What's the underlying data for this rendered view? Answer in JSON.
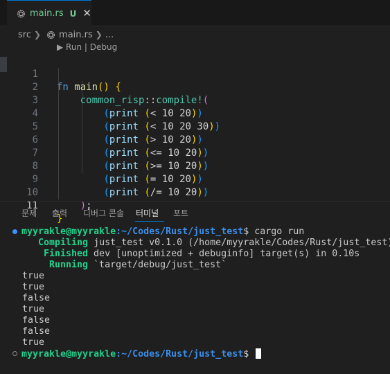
{
  "tab": {
    "filename": "main.rs",
    "git_status": "U",
    "close_glyph": "✕"
  },
  "breadcrumb": {
    "folder": "src",
    "file": "main.rs",
    "more": "..."
  },
  "codelens": "▶ Run | Debug",
  "code": {
    "line_numbers": [
      "1",
      "2",
      "3",
      "4",
      "5",
      "6",
      "7",
      "8",
      "9",
      "10",
      "11"
    ],
    "l1": {
      "kw": "fn",
      "name": "main",
      "parens": "()",
      "brace": "{"
    },
    "l2": {
      "mod": "common_risp",
      "sep": "::",
      "mac": "compile",
      "bang": "!",
      "open": "("
    },
    "prints": [
      {
        "op": "<",
        "args": "10 20"
      },
      {
        "op": "<",
        "args": "10 20 30"
      },
      {
        "op": ">",
        "args": "10 20"
      },
      {
        "op": "<=",
        "args": "10 20"
      },
      {
        "op": ">=",
        "args": "10 20"
      },
      {
        "op": "=",
        "args": "10 20"
      },
      {
        "op": "/=",
        "args": "10 20"
      }
    ],
    "print_kw": "print",
    "l10": {
      "close": ")",
      "semi": ";"
    },
    "l11": {
      "brace": "}"
    }
  },
  "panel": {
    "tabs": [
      "문제",
      "출력",
      "디버그 콘솔",
      "터미널",
      "포트"
    ],
    "active_tab": "터미널"
  },
  "terminal": {
    "user": "myyrakle@myyrakle",
    "cwd": ":~/Codes/Rust/just_test",
    "prompt_char": "$",
    "command": " cargo run",
    "compiling_verb": "Compiling",
    "compiling_text": " just_test v0.1.0 (/home/myyrakle/Codes/Rust/just_test)",
    "finished_verb": "Finished",
    "finished_text": " dev [unoptimized + debuginfo] target(s) in 0.10s",
    "running_verb": "Running",
    "running_text": " `target/debug/just_test`",
    "output": [
      "true",
      "true",
      "false",
      "true",
      "false",
      "false",
      "true"
    ]
  }
}
